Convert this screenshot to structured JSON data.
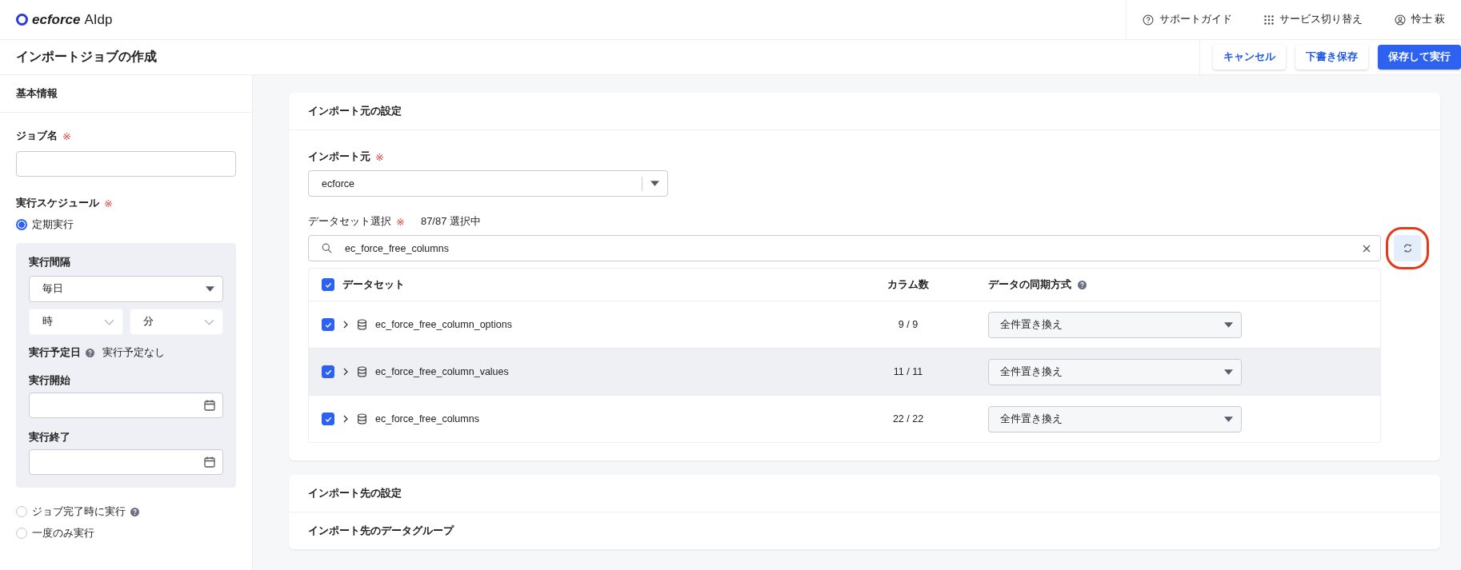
{
  "brand": {
    "name": "ecforce",
    "product": "AIdp"
  },
  "header_links": [
    {
      "label": "サポートガイド",
      "kind": "help"
    },
    {
      "label": "サービス切り替え",
      "kind": "grid"
    },
    {
      "label": "怜士 萩",
      "kind": "user"
    }
  ],
  "page": {
    "title": "インポートジョブの作成",
    "actions": [
      {
        "label": "キャンセル",
        "kind": "secondary"
      },
      {
        "label": "下書き保存",
        "kind": "secondary"
      },
      {
        "label": "保存して実行",
        "kind": "primary"
      }
    ]
  },
  "basic_info": {
    "heading": "基本情報",
    "job_name": {
      "label": "ジョブ名",
      "required_mark": "※"
    },
    "schedule": {
      "label": "実行スケジュール",
      "required_mark": "※",
      "options": [
        {
          "label": "定期実行",
          "selected": true,
          "help": false
        },
        {
          "label": "ジョブ完了時に実行",
          "selected": false,
          "help": true
        },
        {
          "label": "一度のみ実行",
          "selected": false,
          "help": false
        }
      ]
    },
    "recurring": {
      "interval_label": "実行間隔",
      "interval_value": "毎日",
      "hour_placeholder": "時",
      "minute_placeholder": "分",
      "next_run_label": "実行予定日",
      "next_run_value": "実行予定なし",
      "start_label": "実行開始",
      "end_label": "実行終了"
    }
  },
  "import_source": {
    "heading": "インポート元の設定",
    "source_label": "インポート元",
    "source_required_mark": "※",
    "source_value": "ecforce",
    "dataset_label": "データセット選択",
    "dataset_required_mark": "※",
    "selection_count": "87/87 選択中",
    "search_value": "ec_force_free_columns",
    "table": {
      "all_checked": true,
      "columns": [
        "データセット",
        "カラム数",
        "データの同期方式"
      ],
      "rows": [
        {
          "name": "ec_force_free_column_options",
          "checked": true,
          "expanded": false,
          "column_count": "9 / 9",
          "sync_mode": "全件置き換え",
          "hovered": false
        },
        {
          "name": "ec_force_free_column_values",
          "checked": true,
          "expanded": false,
          "column_count": "11 / 11",
          "sync_mode": "全件置き換え",
          "hovered": true
        },
        {
          "name": "ec_force_free_columns",
          "checked": true,
          "expanded": false,
          "column_count": "22 / 22",
          "sync_mode": "全件置き換え",
          "hovered": false
        }
      ]
    }
  },
  "import_destination": {
    "heading": "インポート先の設定",
    "field_label": "インポート先のデータグループ"
  }
}
